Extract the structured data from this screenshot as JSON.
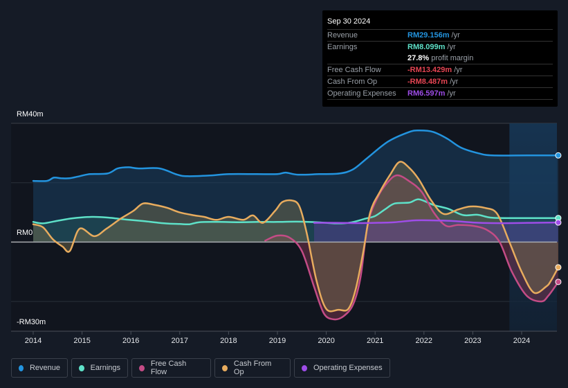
{
  "tooltip": {
    "date": "Sep 30 2024",
    "rows": [
      {
        "label": "Revenue",
        "value": "RM29.156m",
        "unit": "/yr",
        "color": "#2394df"
      },
      {
        "label": "Earnings",
        "value": "RM8.099m",
        "unit": "/yr",
        "color": "#5ee1c8"
      },
      {
        "label": "",
        "value": "27.8%",
        "unit": "profit margin",
        "color": "#ffffff"
      },
      {
        "label": "Free Cash Flow",
        "value": "-RM13.429m",
        "unit": "/yr",
        "color": "#e64553"
      },
      {
        "label": "Cash From Op",
        "value": "-RM8.487m",
        "unit": "/yr",
        "color": "#e64553"
      },
      {
        "label": "Operating Expenses",
        "value": "RM6.597m",
        "unit": "/yr",
        "color": "#9e4de8"
      }
    ]
  },
  "legend": [
    {
      "label": "Revenue",
      "color": "#2394df"
    },
    {
      "label": "Earnings",
      "color": "#5ee1c8"
    },
    {
      "label": "Free Cash Flow",
      "color": "#c44c86"
    },
    {
      "label": "Cash From Op",
      "color": "#e8ac5e"
    },
    {
      "label": "Operating Expenses",
      "color": "#9e4de8"
    }
  ],
  "chart_data": {
    "type": "area",
    "title": "",
    "xlabel": "",
    "ylabel": "",
    "y_tick_labels": [
      "RM40m",
      "RM0",
      "-RM30m"
    ],
    "ylim": [
      -30,
      40
    ],
    "xlim": [
      2013.5,
      2024.75
    ],
    "x_ticks": [
      2014,
      2015,
      2016,
      2017,
      2018,
      2019,
      2020,
      2021,
      2022,
      2023,
      2024
    ],
    "x_tick_labels": [
      "2014",
      "2015",
      "2016",
      "2017",
      "2018",
      "2019",
      "2020",
      "2021",
      "2022",
      "2023",
      "2024"
    ],
    "highlight_from": 2023.75,
    "grid": true,
    "series": [
      {
        "name": "Revenue",
        "color": "#2394df",
        "x": [
          2014.0,
          2014.28,
          2014.42,
          2014.57,
          2014.74,
          2014.95,
          2015.16,
          2015.52,
          2015.73,
          2015.95,
          2016.16,
          2016.59,
          2016.95,
          2017.16,
          2017.59,
          2018.01,
          2018.58,
          2019.0,
          2019.17,
          2019.42,
          2019.85,
          2020.27,
          2020.55,
          2020.84,
          2021.27,
          2021.7,
          2021.91,
          2022.19,
          2022.48,
          2022.76,
          2023.12,
          2023.4,
          2024.12,
          2024.75
        ],
        "values": [
          20.6,
          20.6,
          21.7,
          21.5,
          21.5,
          22.2,
          22.9,
          23.1,
          24.8,
          25.2,
          24.8,
          24.8,
          22.7,
          22.2,
          22.4,
          22.9,
          22.9,
          22.9,
          23.4,
          22.7,
          22.9,
          23.1,
          24.5,
          28.3,
          33.9,
          37.1,
          37.6,
          37.1,
          34.8,
          31.8,
          29.9,
          29.2,
          29.2,
          29.2
        ]
      },
      {
        "name": "Earnings",
        "color": "#5ee1c8",
        "x": [
          2014.0,
          2014.2,
          2014.5,
          2014.8,
          2015.2,
          2015.5,
          2015.9,
          2016.3,
          2016.7,
          2017.0,
          2017.2,
          2017.4,
          2017.8,
          2018.2,
          2018.6,
          2019.0,
          2019.4,
          2019.8,
          2020.2,
          2020.5,
          2020.8,
          2021.0,
          2021.2,
          2021.4,
          2021.7,
          2021.9,
          2022.2,
          2022.5,
          2022.8,
          2023.1,
          2023.4,
          2024.0,
          2024.75
        ],
        "values": [
          6.8,
          6.3,
          7.2,
          8.0,
          8.5,
          8.3,
          7.6,
          7.0,
          6.3,
          6.1,
          6.0,
          6.7,
          6.8,
          6.7,
          6.8,
          6.8,
          6.9,
          6.7,
          6.3,
          6.6,
          7.9,
          8.8,
          11.0,
          13.0,
          13.3,
          14.4,
          12.5,
          11.2,
          9.1,
          9.2,
          8.2,
          8.1,
          8.1
        ]
      },
      {
        "name": "Free Cash Flow",
        "color": "#c44c86",
        "x": [
          2018.75,
          2019.0,
          2019.25,
          2019.5,
          2019.75,
          2019.95,
          2020.15,
          2020.35,
          2020.55,
          2020.7,
          2020.85,
          2021.05,
          2021.25,
          2021.45,
          2021.7,
          2021.95,
          2022.2,
          2022.45,
          2022.7,
          2023.0,
          2023.3,
          2023.55,
          2023.8,
          2024.1,
          2024.4,
          2024.55,
          2024.75
        ],
        "values": [
          0.5,
          2.2,
          1.5,
          -3.0,
          -15.0,
          -24.0,
          -26.0,
          -25.0,
          -21.0,
          -12.0,
          6.0,
          15.0,
          20.0,
          22.5,
          20.5,
          17.0,
          10.0,
          5.5,
          5.8,
          5.5,
          4.0,
          0.0,
          -10.0,
          -18.0,
          -20.0,
          -18.0,
          -13.4
        ]
      },
      {
        "name": "Cash From Op",
        "color": "#e8ac5e",
        "x": [
          2014.0,
          2014.2,
          2014.4,
          2014.6,
          2014.75,
          2014.95,
          2015.25,
          2015.5,
          2015.8,
          2016.05,
          2016.25,
          2016.5,
          2016.75,
          2017.0,
          2017.3,
          2017.5,
          2017.75,
          2018.0,
          2018.3,
          2018.5,
          2018.7,
          2018.95,
          2019.1,
          2019.3,
          2019.45,
          2019.6,
          2019.8,
          2020.0,
          2020.25,
          2020.45,
          2020.6,
          2020.75,
          2020.9,
          2021.1,
          2021.3,
          2021.5,
          2021.7,
          2021.9,
          2022.15,
          2022.4,
          2022.7,
          2022.95,
          2023.25,
          2023.5,
          2023.75,
          2024.0,
          2024.25,
          2024.5,
          2024.6,
          2024.75
        ],
        "values": [
          6.0,
          5.0,
          1.0,
          -1.5,
          -3.0,
          4.5,
          2.0,
          4.5,
          8.0,
          10.5,
          13.0,
          12.5,
          11.5,
          10.0,
          9.0,
          8.5,
          7.5,
          8.5,
          7.5,
          9.0,
          6.5,
          10.5,
          13.5,
          14.0,
          12.0,
          3.0,
          -13.0,
          -22.5,
          -22.8,
          -22.5,
          -16.0,
          -4.0,
          10.0,
          17.0,
          22.5,
          27.0,
          25.0,
          21.0,
          14.0,
          9.5,
          11.0,
          12.0,
          11.5,
          9.5,
          0.0,
          -10.0,
          -17.0,
          -15.0,
          -13.0,
          -8.5
        ]
      },
      {
        "name": "Operating Expenses",
        "color": "#9e4de8",
        "x": [
          2019.75,
          2020.2,
          2020.6,
          2021.0,
          2021.4,
          2021.8,
          2022.2,
          2022.6,
          2023.0,
          2023.4,
          2023.8,
          2024.2,
          2024.75
        ],
        "values": [
          6.5,
          6.5,
          6.4,
          6.5,
          6.7,
          7.3,
          7.3,
          7.1,
          6.6,
          6.4,
          6.4,
          6.5,
          6.6
        ]
      }
    ]
  }
}
